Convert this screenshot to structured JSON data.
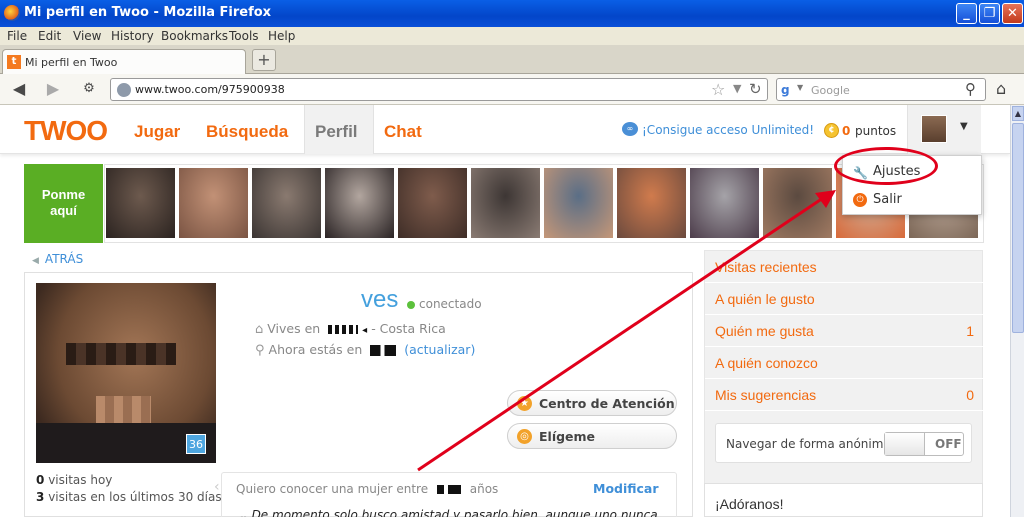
{
  "window": {
    "title": "Mi perfil en Twoo - Mozilla Firefox"
  },
  "menu": [
    "File",
    "Edit",
    "View",
    "History",
    "Bookmarks",
    "Tools",
    "Help"
  ],
  "tabs": [
    {
      "label": "Mi perfil en Twoo"
    }
  ],
  "nav": {
    "url": "www.twoo.com/975900938",
    "search_placeholder": "Google",
    "search_engine_letter": "g"
  },
  "site": {
    "logo": "TWOO",
    "links": [
      "Jugar",
      "Búsqueda",
      "Perfil",
      "Chat"
    ],
    "unlimited": "¡Consigue acceso Unlimited!",
    "points_value": "0",
    "points_label": "puntos"
  },
  "dropdown": {
    "items": [
      {
        "label": "Ajustes",
        "icon": "wrench-icon"
      },
      {
        "label": "Salir",
        "icon": "power-icon"
      }
    ]
  },
  "strip": {
    "ponme_line1": "Ponme",
    "ponme_line2": "aquí",
    "photo_count": 12
  },
  "back": "ATRÁS",
  "profile": {
    "username": "ves",
    "status": "conectado",
    "badge": "36",
    "lives_label": "Vives en",
    "lives_country": "- Costa Rica",
    "now_label": "Ahora estás en",
    "update_link": "(actualizar)",
    "visits_today_n": "0",
    "visits_today": "visitas hoy",
    "visits_30_n": "3",
    "visits_30": "visitas en los últimos 30 días",
    "want_prefix": "Quiero conocer una mujer entre",
    "want_suffix": "años",
    "modify": "Modificar",
    "bio": "De momento solo busco amistad y pasarlo bien, aunque uno nunca sabe a quien puede hallar en el camino ;D"
  },
  "buttons": {
    "center": "Centro de Atención",
    "choose": "Elígeme"
  },
  "sidebar": {
    "items": [
      {
        "label": "Visitas recientes",
        "count": ""
      },
      {
        "label": "A quién le gusto",
        "count": ""
      },
      {
        "label": "Quién me gusta",
        "count": "1"
      },
      {
        "label": "A quién conozco",
        "count": ""
      },
      {
        "label": "Mis sugerencias",
        "count": "0"
      }
    ],
    "anon_label": "Navegar de forma anónima",
    "anon_state": "OFF",
    "adoranos": "¡Adóranos!"
  },
  "colors": {
    "brand": "#f26a10",
    "link": "#3f8fd8",
    "ponme": "#5aae24",
    "annotation": "#e0001b"
  }
}
